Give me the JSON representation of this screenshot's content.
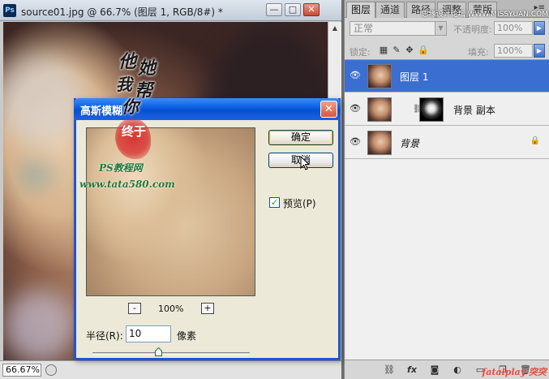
{
  "document": {
    "app_icon": "Ps",
    "title": "source01.jpg @ 66.7% (图层 1, RGB/8#) *",
    "minimize_icon": "—",
    "restore_icon": "□",
    "close_icon": "✕",
    "zoom": "66.67%"
  },
  "layers_panel": {
    "tabs": [
      "图层",
      "通道",
      "路径",
      "调整",
      "蒙版"
    ],
    "blend_mode": "正常",
    "opacity_label": "不透明度:",
    "opacity_value": "100%",
    "lock_label": "锁定:",
    "fill_label": "填充:",
    "fill_value": "100%",
    "layers": [
      {
        "name": "图层 1",
        "selected": true
      },
      {
        "name": "背景 副本",
        "selected": false
      },
      {
        "name": "背景",
        "selected": false
      }
    ],
    "watermark_top": "思缘设计论坛 WWW.MISSYUAN.COM",
    "watermark_bottom": "fatalplay 突突"
  },
  "dialog": {
    "title": "高斯模糊",
    "close_icon": "✕",
    "ok_label": "确定",
    "cancel_label": "取消",
    "preview_label": "预览(P)",
    "preview_checked": true,
    "zoom_out": "-",
    "zoom_in": "+",
    "zoom_label": "100%",
    "radius_label": "半径(R):",
    "radius_value": "10",
    "radius_unit": "像素",
    "slider_position": 0.42
  },
  "overlay": {
    "calligraphy": [
      "他",
      "她",
      "我",
      "帮",
      "你"
    ],
    "seal": "终于",
    "site_name": "PS教程网",
    "site_url": "www.tata580.com"
  },
  "colors": {
    "selection_blue": "#3a6fd1",
    "dialog_title_blue": "#0a5de2",
    "close_red": "#d35b3b"
  }
}
